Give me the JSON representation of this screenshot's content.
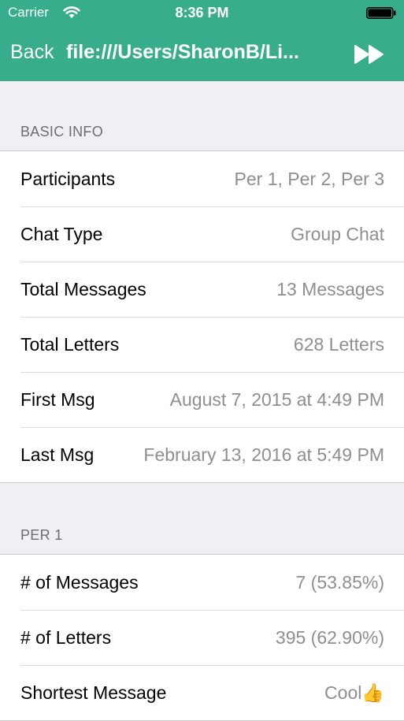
{
  "status_bar": {
    "carrier": "Carrier",
    "time": "8:36 PM"
  },
  "navbar": {
    "back_label": "Back",
    "title": "file:///Users/SharonB/Li..."
  },
  "sections": [
    {
      "header": "BASIC INFO",
      "rows": [
        {
          "label": "Participants",
          "value": "Per 1, Per 2, Per 3"
        },
        {
          "label": "Chat Type",
          "value": "Group Chat"
        },
        {
          "label": "Total Messages",
          "value": "13 Messages"
        },
        {
          "label": "Total Letters",
          "value": "628 Letters"
        },
        {
          "label": "First Msg",
          "value": "August 7, 2015 at 4:49 PM"
        },
        {
          "label": "Last Msg",
          "value": "February 13, 2016 at 5:49 PM"
        }
      ]
    },
    {
      "header": "PER 1",
      "rows": [
        {
          "label": "# of Messages",
          "value": "7 (53.85%)"
        },
        {
          "label": "# of Letters",
          "value": "395 (62.90%)"
        },
        {
          "label": "Shortest Message",
          "value": "Cool👍"
        }
      ]
    }
  ],
  "colors": {
    "accent": "#37ad8b",
    "background": "#efeff4",
    "value_text": "#8e8e93",
    "section_header_text": "#6d6d72"
  }
}
